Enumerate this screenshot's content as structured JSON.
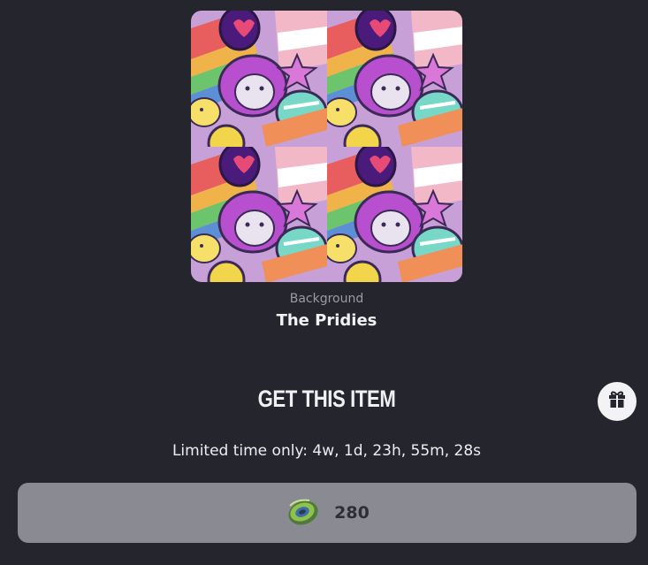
{
  "item": {
    "category": "Background",
    "name": "The Pridies",
    "preview_icon": "pride-doodle-pattern-image"
  },
  "purchase": {
    "heading": "GET THIS ITEM",
    "limited_time": "Limited time only: 4w, 1d, 23h, 55m, 28s",
    "price": "280",
    "currency_icon": "coin-icon",
    "gift_icon": "gift-icon"
  },
  "colors": {
    "background": "#25262d",
    "button": "#8a8b92",
    "gift_button": "#f3f3f5"
  }
}
